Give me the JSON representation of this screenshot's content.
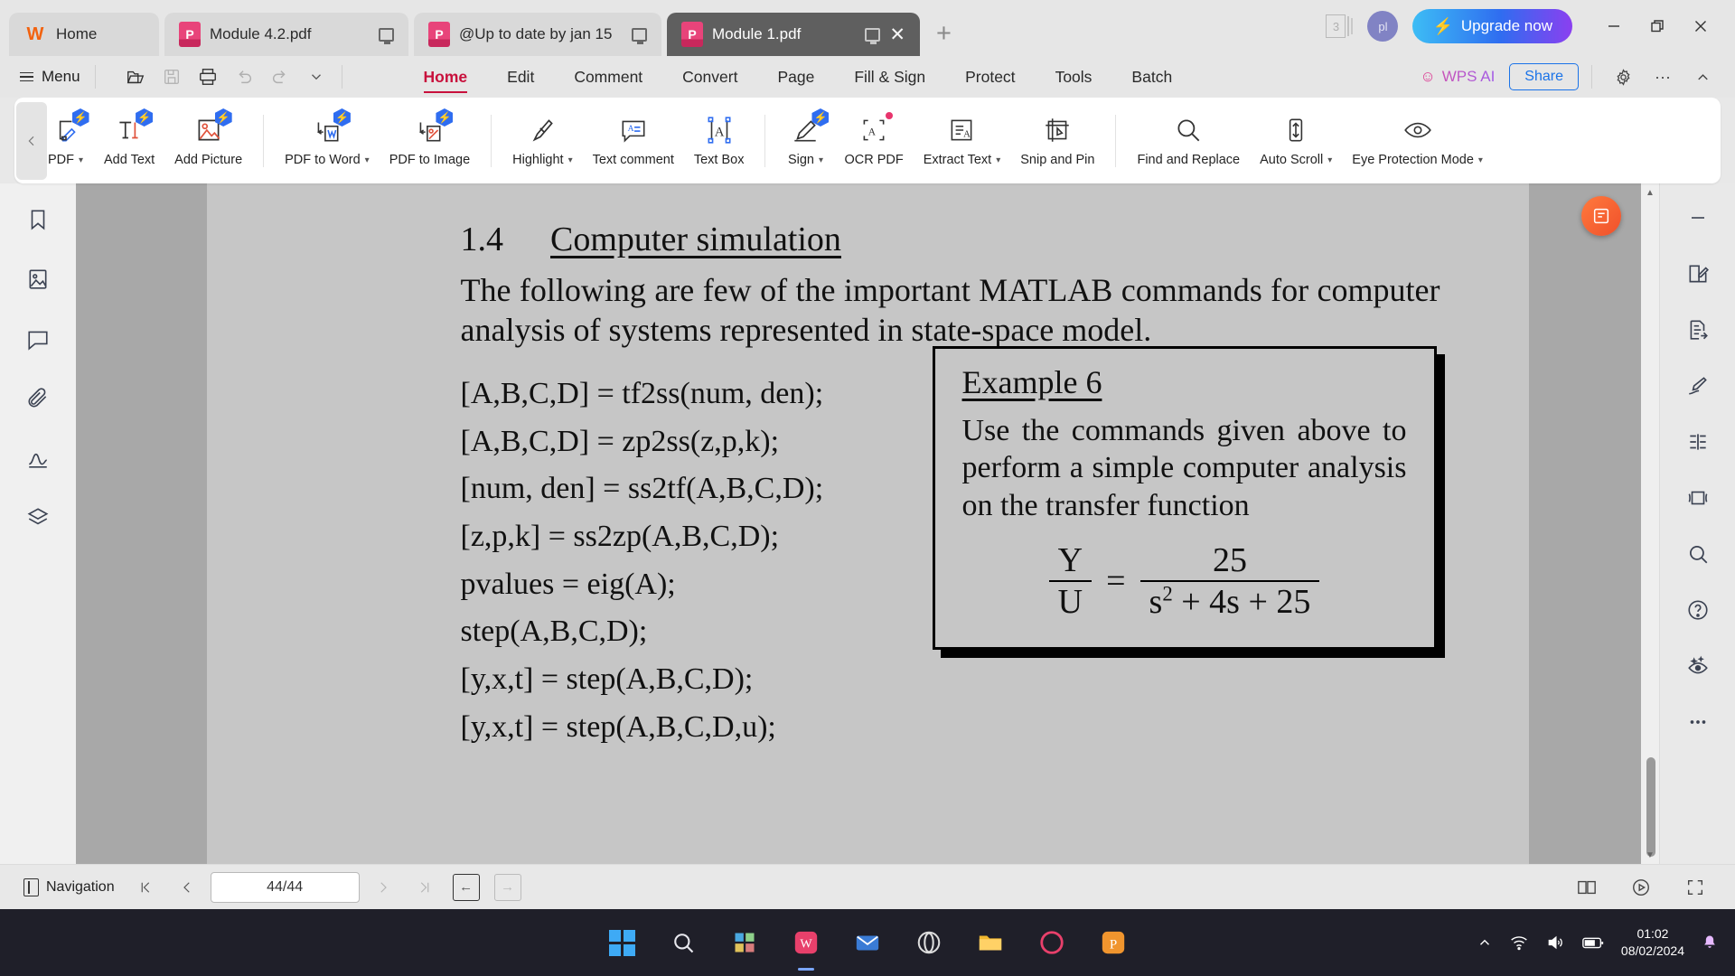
{
  "window": {
    "tabs": [
      {
        "label": "Home",
        "icon": "wps-logo-icon",
        "type": "home",
        "active": false
      },
      {
        "label": "Module 4.2.pdf",
        "icon": "pdf-file-icon",
        "type": "pdf",
        "active": false
      },
      {
        "label": "@Up to date by jan 15",
        "icon": "pdf-file-icon",
        "type": "pdf",
        "active": false
      },
      {
        "label": "Module 1.pdf",
        "icon": "pdf-file-icon",
        "type": "pdf",
        "active": true
      }
    ],
    "new_tab_label": "+",
    "doc_stack_count": "3",
    "avatar_initials": "pl",
    "upgrade_label": "Upgrade now",
    "minimize_label": "—",
    "restore_label": "❐",
    "close_label": "✕"
  },
  "menubar": {
    "menu_label": "Menu",
    "quick_icons": [
      {
        "name": "open-folder-icon"
      },
      {
        "name": "save-icon"
      },
      {
        "name": "print-icon"
      },
      {
        "name": "undo-icon"
      },
      {
        "name": "redo-icon"
      },
      {
        "name": "chevron-down-icon"
      }
    ],
    "tabs": [
      {
        "label": "Home",
        "selected": true
      },
      {
        "label": "Edit",
        "selected": false
      },
      {
        "label": "Comment",
        "selected": false
      },
      {
        "label": "Convert",
        "selected": false
      },
      {
        "label": "Page",
        "selected": false
      },
      {
        "label": "Fill & Sign",
        "selected": false
      },
      {
        "label": "Protect",
        "selected": false
      },
      {
        "label": "Tools",
        "selected": false
      },
      {
        "label": "Batch",
        "selected": false
      }
    ],
    "wps_ai_label": "WPS AI",
    "share_label": "Share",
    "settings_icon": "gear-icon",
    "more_icon": "more-horizontal-icon",
    "collapse_icon": "chevron-up-icon"
  },
  "toolbar": {
    "scroll_left_icon": "chevron-left-icon",
    "items": [
      {
        "label": "PDF",
        "icon": "edit-pdf-icon",
        "ai": true,
        "caret": true,
        "clipped": true
      },
      {
        "label": "Add Text",
        "icon": "add-text-icon",
        "ai": true,
        "caret": false
      },
      {
        "label": "Add Picture",
        "icon": "add-picture-icon",
        "ai": true,
        "caret": false
      },
      {
        "sep": true
      },
      {
        "label": "PDF to Word",
        "icon": "pdf-to-word-icon",
        "ai": true,
        "caret": true
      },
      {
        "label": "PDF to Image",
        "icon": "pdf-to-image-icon",
        "ai": true,
        "caret": false
      },
      {
        "sep": true
      },
      {
        "label": "Highlight",
        "icon": "highlight-pen-icon",
        "ai": false,
        "caret": true
      },
      {
        "label": "Text comment",
        "icon": "text-comment-icon",
        "ai": false,
        "caret": false
      },
      {
        "label": "Text Box",
        "icon": "text-box-icon",
        "ai": false,
        "caret": false
      },
      {
        "sep": true
      },
      {
        "label": "Sign",
        "icon": "sign-icon",
        "ai": true,
        "caret": true
      },
      {
        "label": "OCR PDF",
        "icon": "ocr-pdf-icon",
        "dot": true,
        "caret": false
      },
      {
        "label": "Extract Text",
        "icon": "extract-text-icon",
        "ai": false,
        "caret": true
      },
      {
        "label": "Snip and Pin",
        "icon": "snip-and-pin-icon",
        "ai": false,
        "caret": false
      },
      {
        "sep": true
      },
      {
        "label": "Find and Replace",
        "icon": "search-icon",
        "ai": false,
        "caret": false
      },
      {
        "label": "Auto Scroll",
        "icon": "auto-scroll-icon",
        "ai": false,
        "caret": true
      },
      {
        "label": "Eye Protection Mode",
        "icon": "eye-icon",
        "ai": false,
        "caret": true
      }
    ]
  },
  "left_rail": [
    {
      "name": "bookmark-icon"
    },
    {
      "name": "thumbnail-icon"
    },
    {
      "name": "comment-icon"
    },
    {
      "name": "attachment-icon"
    },
    {
      "name": "signature-icon"
    },
    {
      "name": "layers-icon"
    }
  ],
  "right_rail": [
    {
      "name": "collapse-minus-icon"
    },
    {
      "name": "edit-square-icon"
    },
    {
      "name": "export-doc-icon"
    },
    {
      "name": "fountain-pen-icon"
    },
    {
      "name": "align-icon"
    },
    {
      "name": "compress-icon"
    },
    {
      "name": "search-icon"
    },
    {
      "name": "help-circle-icon"
    },
    {
      "name": "eye-sparkle-icon"
    },
    {
      "name": "more-dots-icon"
    }
  ],
  "document": {
    "section_number": "1.4",
    "section_title": "Computer simulation",
    "paragraph": "The following are few of the important MATLAB commands for computer analysis of systems represented in state-space model.",
    "code_lines": [
      "[A,B,C,D] = tf2ss(num, den);",
      "[A,B,C,D] = zp2ss(z,p,k);",
      "[num, den] = ss2tf(A,B,C,D);",
      "[z,p,k] = ss2zp(A,B,C,D);",
      "pvalues = eig(A);",
      "step(A,B,C,D);",
      "[y,x,t] = step(A,B,C,D);",
      "[y,x,t] = step(A,B,C,D,u);"
    ],
    "example": {
      "title": "Example 6",
      "text": "Use the commands given above to perform a simple computer analysis on the transfer function",
      "equation": {
        "lhs_num": "Y",
        "lhs_den": "U",
        "equals": "=",
        "rhs_num": "25",
        "rhs_den_base": "s",
        "rhs_den_exp": "2",
        "rhs_den_rest": "+ 4s + 25"
      }
    },
    "float_button_icon": "ai-assistant-icon"
  },
  "statusbar": {
    "navigation_label": "Navigation",
    "first_page_icon": "first-page-icon",
    "prev_page_icon": "prev-page-icon",
    "page_value": "44/44",
    "next_page_icon": "next-page-icon",
    "last_page_icon": "last-page-icon",
    "back_icon": "back-arrow-icon",
    "forward_icon": "forward-arrow-icon",
    "dual_page_icon": "dual-page-icon",
    "present_icon": "presentation-icon",
    "fullscreen_icon": "fullscreen-icon"
  },
  "taskbar": {
    "icons": [
      {
        "name": "windows-start-icon"
      },
      {
        "name": "search-icon"
      },
      {
        "name": "widgets-icon"
      },
      {
        "name": "wps-office-icon",
        "active": true
      },
      {
        "name": "mail-icon"
      },
      {
        "name": "opera-icon"
      },
      {
        "name": "file-explorer-icon"
      },
      {
        "name": "vivaldi-icon"
      },
      {
        "name": "pdf-app-icon"
      }
    ],
    "tray": {
      "chevron_icon": "chevron-up-icon",
      "wifi_icon": "wifi-icon",
      "volume_icon": "volume-icon",
      "battery_icon": "battery-icon",
      "time": "01:02",
      "date": "08/02/2024",
      "notification_icon": "bell-icon"
    }
  },
  "colors": {
    "accent_red": "#c8103c",
    "accent_blue": "#1a73e8",
    "ai_badge": "#2f6df0",
    "page_bg": "#c6c6c6",
    "taskbar_bg": "#1f1f29"
  }
}
